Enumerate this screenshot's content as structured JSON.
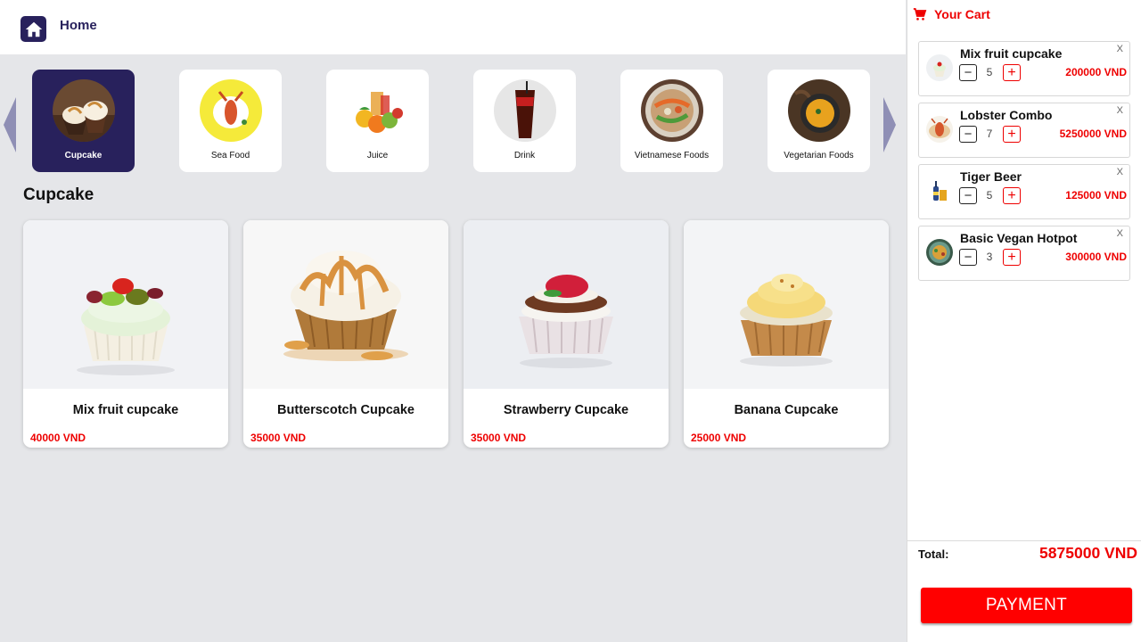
{
  "header": {
    "title": "Home",
    "icon": "home-icon"
  },
  "categories": [
    {
      "label": "Cupcake",
      "active": true
    },
    {
      "label": "Sea Food",
      "active": false
    },
    {
      "label": "Juice",
      "active": false
    },
    {
      "label": "Drink",
      "active": false
    },
    {
      "label": "Vietnamese Foods",
      "active": false
    },
    {
      "label": "Vegetarian Foods",
      "active": false
    }
  ],
  "section": {
    "title": "Cupcake"
  },
  "products": [
    {
      "name": "Mix fruit cupcake",
      "price": "40000 VND"
    },
    {
      "name": "Butterscotch Cupcake",
      "price": "35000 VND"
    },
    {
      "name": "Strawberry Cupcake",
      "price": "35000 VND"
    },
    {
      "name": "Banana Cupcake",
      "price": "25000 VND"
    }
  ],
  "cart": {
    "title": "Your Cart",
    "icon": "cart-icon",
    "remove_label": "X",
    "items": [
      {
        "name": "Mix fruit cupcake",
        "qty": "5",
        "price": "200000 VND"
      },
      {
        "name": "Lobster Combo",
        "qty": "7",
        "price": "5250000 VND"
      },
      {
        "name": "Tiger Beer",
        "qty": "5",
        "price": "125000 VND"
      },
      {
        "name": "Basic Vegan Hotpot",
        "qty": "3",
        "price": "300000 VND"
      }
    ],
    "total_label": "Total:",
    "total_value": "5875000 VND",
    "payment_label": "PAYMENT"
  },
  "colors": {
    "brand": "#28215c",
    "accent": "#ee0000",
    "background": "#e5e6e9"
  }
}
